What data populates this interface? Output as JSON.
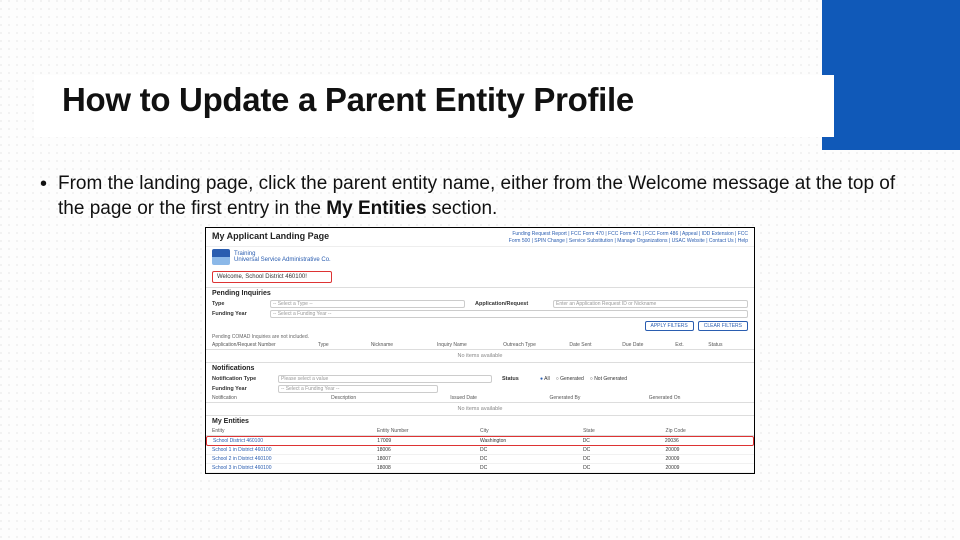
{
  "title": "How to Update a Parent Entity Profile",
  "bullet": {
    "prefix": "From the landing page, click the parent entity name, either from the Welcome message at the top of the page or the first entry in the ",
    "bold": "My Entities",
    "suffix": " section."
  },
  "shot": {
    "page_title": "My Applicant Landing Page",
    "top_links_1": "Funding Request Report | FCC Form 470 | FCC Form 471 | FCC Form 486 | Appeal | IDD Extension | FCC",
    "top_links_2": "Form 500 | SPIN Change | Service Substitution | Manage Organizations | USAC Website | Contact Us | Help",
    "logo_text_1": "Training",
    "logo_text_2": "Universal Service Administrative Co.",
    "welcome": "Welcome, School District 460100!",
    "pending_title": "Pending Inquiries",
    "type_label": "Type",
    "type_ph": "-- Select a Type --",
    "appreq_label": "Application/Request",
    "appreq_ph": "Enter an Application Request ID or Nickname",
    "fy_label": "Funding Year",
    "fy_ph": "-- Select a Funding Year --",
    "apply_btn": "APPLY FILTERS",
    "clear_btn": "CLEAR FILTERS",
    "pending_note": "Pending COMAD Inquiries are not included.",
    "pending_cols": [
      "Application/Request Number",
      "Type",
      "Nickname",
      "Inquiry Name",
      "Outreach Type",
      "Date Sent",
      "Due Date",
      "Ext.",
      "Status"
    ],
    "no_items": "No items available",
    "notif_title": "Notifications",
    "notif_type_label": "Notification Type",
    "notif_type_ph": "Please select a value",
    "notif_fy_label": "Funding Year",
    "notif_fy_ph": "-- Select a Funding Year --",
    "status_label": "Status",
    "status_all": "All",
    "status_gen": "Generated",
    "status_ng": "Not Generated",
    "notif_cols": [
      "Notification",
      "Description",
      "Issued Date",
      "Generated By",
      "Generated On"
    ],
    "entities_title": "My Entities",
    "ent_cols": [
      "Entity",
      "Entity Number",
      "City",
      "State",
      "Zip Code"
    ],
    "ent_rows": [
      {
        "name": "School District 460100",
        "num": "17009",
        "city": "Washington",
        "state": "DC",
        "zip": "20036"
      },
      {
        "name": "School 1 in District 460100",
        "num": "18006",
        "city": "DC",
        "state": "DC",
        "zip": "20009"
      },
      {
        "name": "School 2 in District 460100",
        "num": "18007",
        "city": "DC",
        "state": "DC",
        "zip": "20009"
      },
      {
        "name": "School 3 in District 460100",
        "num": "18008",
        "city": "DC",
        "state": "DC",
        "zip": "20009"
      }
    ]
  }
}
